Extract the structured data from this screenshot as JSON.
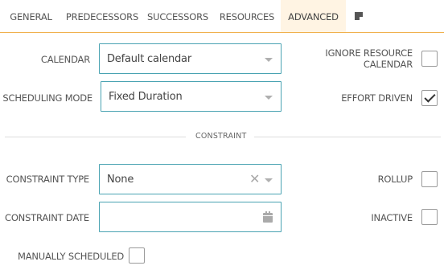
{
  "tabs": [
    {
      "label": "GENERAL",
      "active": false
    },
    {
      "label": "PREDECESSORS",
      "active": false
    },
    {
      "label": "SUCCESSORS",
      "active": false
    },
    {
      "label": "RESOURCES",
      "active": false
    },
    {
      "label": "ADVANCED",
      "active": true
    },
    {
      "icon": "notes-icon",
      "active": false
    }
  ],
  "form": {
    "calendar": {
      "label": "CALENDAR",
      "value": "Default calendar"
    },
    "scheduling_mode": {
      "label": "SCHEDULING MODE",
      "value": "Fixed Duration"
    },
    "ignore_resource_calendar": {
      "label_line1": "IGNORE RESOURCE",
      "label_line2": "CALENDAR",
      "checked": false
    },
    "effort_driven": {
      "label": "EFFORT DRIVEN",
      "checked": true
    },
    "constraint_section": "CONSTRAINT",
    "constraint_type": {
      "label": "CONSTRAINT TYPE",
      "value": "None"
    },
    "constraint_date": {
      "label": "CONSTRAINT DATE",
      "value": ""
    },
    "rollup": {
      "label": "ROLLUP",
      "checked": false
    },
    "inactive": {
      "label": "INACTIVE",
      "checked": false
    },
    "manually_scheduled": {
      "label": "MANUALLY SCHEDULED",
      "checked": false
    }
  },
  "colors": {
    "accent": "#f0b14d",
    "field_border": "#4aa3b2",
    "active_tab_bg": "#fff4e3"
  }
}
